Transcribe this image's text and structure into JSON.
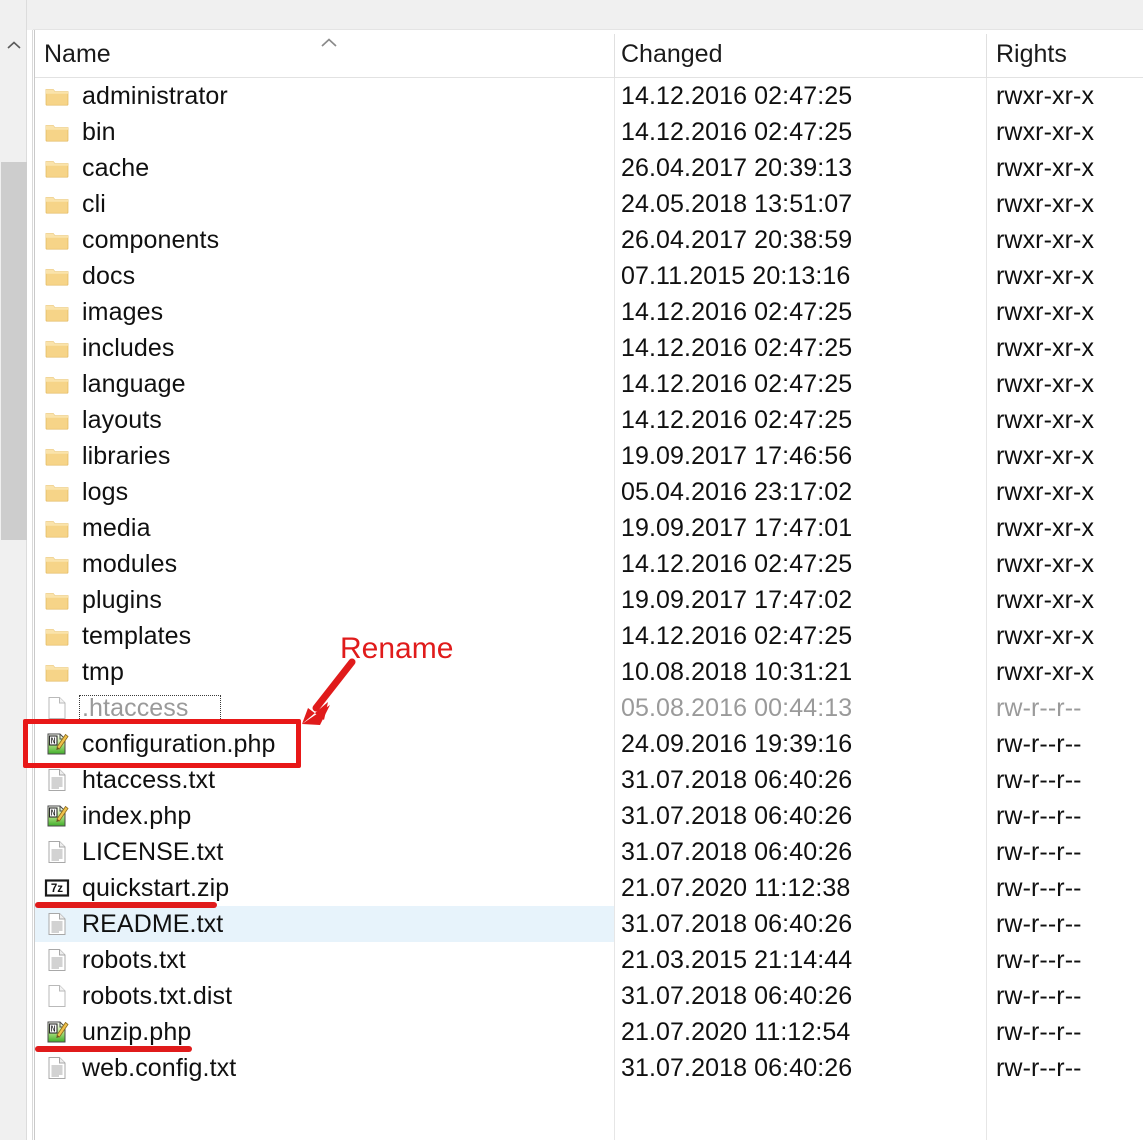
{
  "columns": {
    "name": "Name",
    "changed": "Changed",
    "rights": "Rights",
    "sort_indicator": "sort-ascending-chevron"
  },
  "rows": [
    {
      "icon": "folder-icon",
      "name": "administrator",
      "changed": "14.12.2016 02:47:25",
      "rights": "rwxr-xr-x"
    },
    {
      "icon": "folder-icon",
      "name": "bin",
      "changed": "14.12.2016 02:47:25",
      "rights": "rwxr-xr-x"
    },
    {
      "icon": "folder-icon",
      "name": "cache",
      "changed": "26.04.2017 20:39:13",
      "rights": "rwxr-xr-x"
    },
    {
      "icon": "folder-icon",
      "name": "cli",
      "changed": "24.05.2018 13:51:07",
      "rights": "rwxr-xr-x"
    },
    {
      "icon": "folder-icon",
      "name": "components",
      "changed": "26.04.2017 20:38:59",
      "rights": "rwxr-xr-x"
    },
    {
      "icon": "folder-icon",
      "name": "docs",
      "changed": "07.11.2015 20:13:16",
      "rights": "rwxr-xr-x"
    },
    {
      "icon": "folder-icon",
      "name": "images",
      "changed": "14.12.2016 02:47:25",
      "rights": "rwxr-xr-x"
    },
    {
      "icon": "folder-icon",
      "name": "includes",
      "changed": "14.12.2016 02:47:25",
      "rights": "rwxr-xr-x"
    },
    {
      "icon": "folder-icon",
      "name": "language",
      "changed": "14.12.2016 02:47:25",
      "rights": "rwxr-xr-x"
    },
    {
      "icon": "folder-icon",
      "name": "layouts",
      "changed": "14.12.2016 02:47:25",
      "rights": "rwxr-xr-x"
    },
    {
      "icon": "folder-icon",
      "name": "libraries",
      "changed": "19.09.2017 17:46:56",
      "rights": "rwxr-xr-x"
    },
    {
      "icon": "folder-icon",
      "name": "logs",
      "changed": "05.04.2016 23:17:02",
      "rights": "rwxr-xr-x"
    },
    {
      "icon": "folder-icon",
      "name": "media",
      "changed": "19.09.2017 17:47:01",
      "rights": "rwxr-xr-x"
    },
    {
      "icon": "folder-icon",
      "name": "modules",
      "changed": "14.12.2016 02:47:25",
      "rights": "rwxr-xr-x"
    },
    {
      "icon": "folder-icon",
      "name": "plugins",
      "changed": "19.09.2017 17:47:02",
      "rights": "rwxr-xr-x"
    },
    {
      "icon": "folder-icon",
      "name": "templates",
      "changed": "14.12.2016 02:47:25",
      "rights": "rwxr-xr-x"
    },
    {
      "icon": "folder-icon",
      "name": "tmp",
      "changed": "10.08.2018 10:31:21",
      "rights": "rwxr-xr-x"
    },
    {
      "icon": "blank-file-icon",
      "name": ".htaccess",
      "changed": "05.08.2016 00:44:13",
      "rights": "rw-r--r--",
      "state": "dim-focused"
    },
    {
      "icon": "notepadpp-icon",
      "name": "configuration.php",
      "changed": "24.09.2016 19:39:16",
      "rights": "rw-r--r--"
    },
    {
      "icon": "text-file-icon",
      "name": "htaccess.txt",
      "changed": "31.07.2018 06:40:26",
      "rights": "rw-r--r--"
    },
    {
      "icon": "notepadpp-icon",
      "name": "index.php",
      "changed": "31.07.2018 06:40:26",
      "rights": "rw-r--r--"
    },
    {
      "icon": "text-file-icon",
      "name": "LICENSE.txt",
      "changed": "31.07.2018 06:40:26",
      "rights": "rw-r--r--"
    },
    {
      "icon": "sevenzip-icon",
      "name": "quickstart.zip",
      "changed": "21.07.2020 11:12:38",
      "rights": "rw-r--r--"
    },
    {
      "icon": "text-file-icon",
      "name": "README.txt",
      "changed": "31.07.2018 06:40:26",
      "rights": "rw-r--r--",
      "state": "highlighted"
    },
    {
      "icon": "text-file-icon",
      "name": "robots.txt",
      "changed": "21.03.2015 21:14:44",
      "rights": "rw-r--r--"
    },
    {
      "icon": "blank-file-icon",
      "name": "robots.txt.dist",
      "changed": "31.07.2018 06:40:26",
      "rights": "rw-r--r--"
    },
    {
      "icon": "notepadpp-icon",
      "name": "unzip.php",
      "changed": "21.07.2020 11:12:54",
      "rights": "rw-r--r--"
    },
    {
      "icon": "text-file-icon",
      "name": "web.config.txt",
      "changed": "31.07.2018 06:40:26",
      "rights": "rw-r--r--"
    }
  ],
  "annotations": {
    "label": "Rename",
    "color": "#e01b1b",
    "box_target": "configuration.php",
    "arrow": "arrow-pointing-to-configuration-php",
    "underline_targets": [
      "quickstart.zip",
      "unzip.php"
    ]
  },
  "scrollbar": {
    "up_arrow": "chevron-up-icon",
    "thumb": "scrollbar-thumb"
  },
  "colors": {
    "highlight_row": "#e7f3fb",
    "annotation_red": "#e01b1b",
    "folder_yellow": "#f7d488"
  }
}
